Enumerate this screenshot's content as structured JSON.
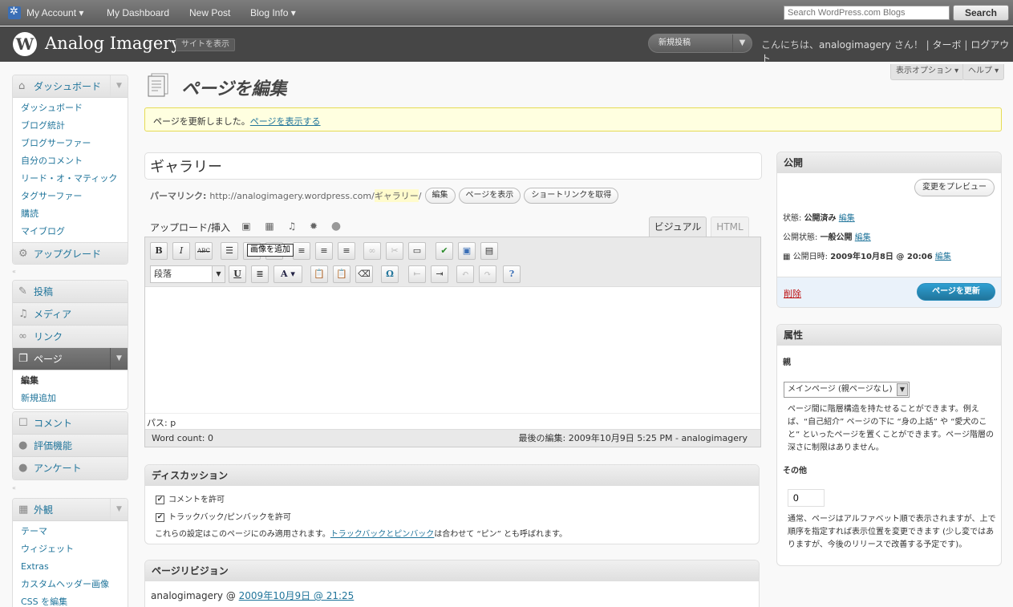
{
  "topbar": {
    "my_account": "My Account ▾",
    "my_dashboard": "My Dashboard",
    "new_post": "New Post",
    "blog_info": "Blog Info ▾",
    "search_placeholder": "Search WordPress.com Blogs",
    "search_button": "Search"
  },
  "header": {
    "logo_glyph": "W",
    "site_title": "Analog Imagery",
    "view_site": "サイトを表示",
    "new_post_select": "新規投稿",
    "greeting_prefix": "こんにちは、",
    "greeting_user": "analogimagery",
    "greeting_suffix": " さん！ | ",
    "turbo": "ターボ",
    "sep": " | ",
    "logout": "ログアウト"
  },
  "screen_options": {
    "options": "表示オプション ▾",
    "help": "ヘルプ ▾"
  },
  "sidebar": {
    "dashboard": {
      "label": "ダッシュボード",
      "items": [
        "ダッシュボード",
        "ブログ統計",
        "ブログサーファー",
        "自分のコメント",
        "リード・オ・マティック",
        "タグサーファー",
        "購読",
        "マイブログ"
      ]
    },
    "upgrade": "アップグレード",
    "posts": "投稿",
    "media": "メディア",
    "links": "リンク",
    "pages": {
      "label": "ページ",
      "items": [
        "編集",
        "新規追加"
      ]
    },
    "comments": "コメント",
    "ratings": "評価機能",
    "polls": "アンケート",
    "appearance": {
      "label": "外観",
      "items": [
        "テーマ",
        "ウィジェット",
        "Extras",
        "カスタムヘッダー画像",
        "CSS を編集"
      ]
    }
  },
  "page": {
    "title": "ページを編集",
    "notice_text": "ページを更新しました。",
    "notice_link": "ページを表示する"
  },
  "editor": {
    "post_title": "ギャラリー",
    "permalink_label": "パーマリンク:",
    "permalink_base": "http://analogimagery.wordpress.com/",
    "permalink_slug": "ギャラリー",
    "permalink_end": "/",
    "edit_btn": "編集",
    "view_btn": "ページを表示",
    "shortlink_btn": "ショートリンクを取得",
    "upload_label": "アップロード/挿入",
    "tooltip": "画像を追加",
    "tab_visual": "ビジュアル",
    "tab_html": "HTML",
    "format": "段落",
    "path": "パス: p",
    "word_count": "Word count: 0",
    "last_edit": "最後の編集: 2009年10月9日 5:25 PM - analogimagery",
    "btn_bold": "B",
    "btn_italic": "I",
    "btn_strike": "ABC",
    "btn_underline": "U",
    "btn_color": "A",
    "btn_omega": "Ω",
    "btn_help": "?"
  },
  "discussion": {
    "title": "ディスカッション",
    "allow_comments": "コメントを許可",
    "allow_pings": "トラックバック/ピンバックを許可",
    "note_prefix": "これらの設定はこのページにのみ適用されます。",
    "note_link": "トラックバックとピンバック",
    "note_suffix": "は合わせて “ピン” とも呼ばれます。"
  },
  "revisions": {
    "title": "ページリビジョン",
    "author": "analogimagery @ ",
    "link": "2009年10月9日 @ 21:25"
  },
  "publish": {
    "title": "公開",
    "preview": "変更をプレビュー",
    "status_label": "状態:",
    "status_value": "公開済み",
    "visibility_label": "公開状態:",
    "visibility_value": "一般公開",
    "date_label": "公開日時:",
    "date_value": "2009年10月8日 @ 20:06",
    "edit": "編集",
    "delete": "削除",
    "update": "ページを更新"
  },
  "attributes": {
    "title": "属性",
    "parent_label": "親",
    "parent_value": "メインページ (親ページなし)",
    "parent_help": "ページ間に階層構造を持たせることができます。例えば、“自己紹介” ページの下に “身の上話” や “愛犬のこと” といったページを置くことができます。ページ階層の深さに制限はありません。",
    "order_label": "その他",
    "order_value": "0",
    "order_help": "通常、ページはアルファベット順で表示されますが、上で順序を指定すれば表示位置を変更できます (少し変ではありますが、今後のリリースで改善する予定です)。"
  }
}
